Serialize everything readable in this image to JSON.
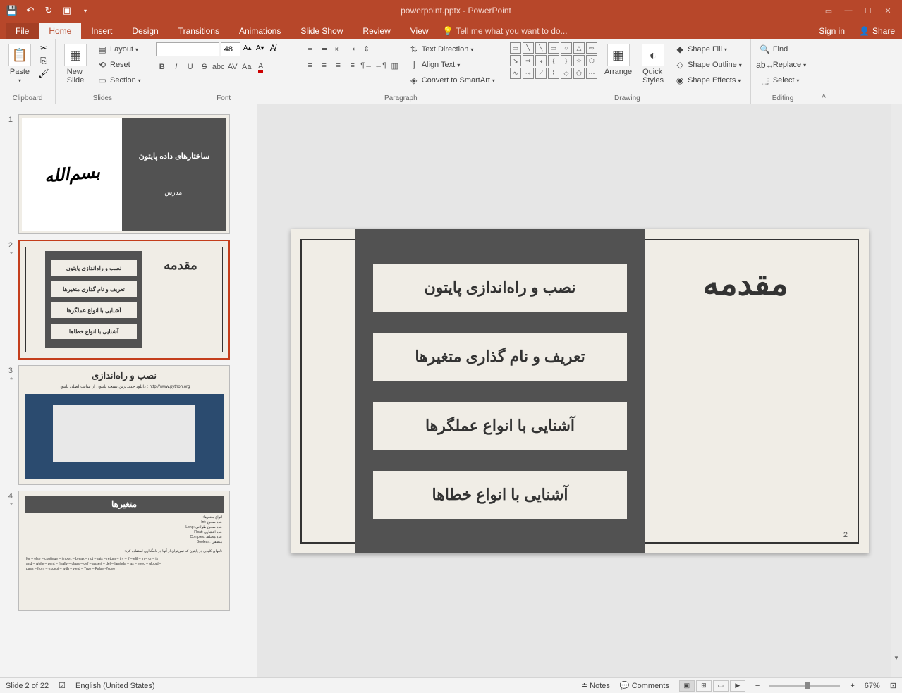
{
  "titlebar": {
    "title": "powerpoint.pptx - PowerPoint"
  },
  "tabs": {
    "file": "File",
    "home": "Home",
    "insert": "Insert",
    "design": "Design",
    "transitions": "Transitions",
    "animations": "Animations",
    "slideshow": "Slide Show",
    "review": "Review",
    "view": "View",
    "tellme": "Tell me what you want to do...",
    "signin": "Sign in",
    "share": "Share"
  },
  "ribbon": {
    "clipboard": {
      "paste": "Paste",
      "label": "Clipboard"
    },
    "slides": {
      "newslide": "New\nSlide",
      "layout": "Layout",
      "reset": "Reset",
      "section": "Section",
      "label": "Slides"
    },
    "font": {
      "size": "48",
      "label": "Font"
    },
    "paragraph": {
      "textdir": "Text Direction",
      "align": "Align Text",
      "smartart": "Convert to SmartArt",
      "label": "Paragraph"
    },
    "drawing": {
      "arrange": "Arrange",
      "quickstyles": "Quick\nStyles",
      "shapefill": "Shape Fill",
      "shapeoutline": "Shape Outline",
      "shapeeffects": "Shape Effects",
      "label": "Drawing"
    },
    "editing": {
      "find": "Find",
      "replace": "Replace",
      "select": "Select",
      "label": "Editing"
    }
  },
  "thumbnails": {
    "s1": {
      "num": "1",
      "title": "ساختارهای  داده  پایتون",
      "sub": "مدرس:"
    },
    "s2": {
      "num": "2",
      "star": "*",
      "title": "مقدمه",
      "b1": "نصب و راه‌اندازی پایتون",
      "b2": "تعریف و نام گذاری متغیرها",
      "b3": "آشنایی با انواع عملگرها",
      "b4": "آشنایی با انواع خطاها"
    },
    "s3": {
      "num": "3",
      "star": "*",
      "title": "نصب و راه‌اندازی",
      "url": "دانلود جدیدترین نسخه پایتون از سایت اصلی پایتون : http://www.python.org"
    },
    "s4": {
      "num": "4",
      "star": "*",
      "title": "متغیرها",
      "l1": "انواع متغیرها:",
      "l2": "عدد صحیح :Int",
      "l3": "عدد صحیح طولانی :Long",
      "l4": "عدد اعشاری :Float",
      "l5": "عدد مختلط :Complex",
      "l6": "منطقی :Boolean",
      "l7": "نامهای کلیدی در پایتون که نمی‌توان از آنها در نامگذاری استفاده کرد:",
      "l8": "for – else – continue – import – break – not – rais – return – try – if – elif – in – or – is",
      "l9": "and – while – print – finally – class – def – assert – del – lambda – as – exec – global –",
      "l10": "pass – from – except – with – yield – True – False –None"
    }
  },
  "slide": {
    "title": "مقدمه",
    "box1": "نصب و راه‌اندازی پایتون",
    "box2": "تعریف و نام گذاری متغیرها",
    "box3": "آشنایی با انواع عملگرها",
    "box4": "آشنایی با انواع خطاها",
    "pagenum": "2"
  },
  "statusbar": {
    "slidecount": "Slide 2 of 22",
    "language": "English (United States)",
    "notes": "Notes",
    "comments": "Comments",
    "zoom": "67%"
  }
}
